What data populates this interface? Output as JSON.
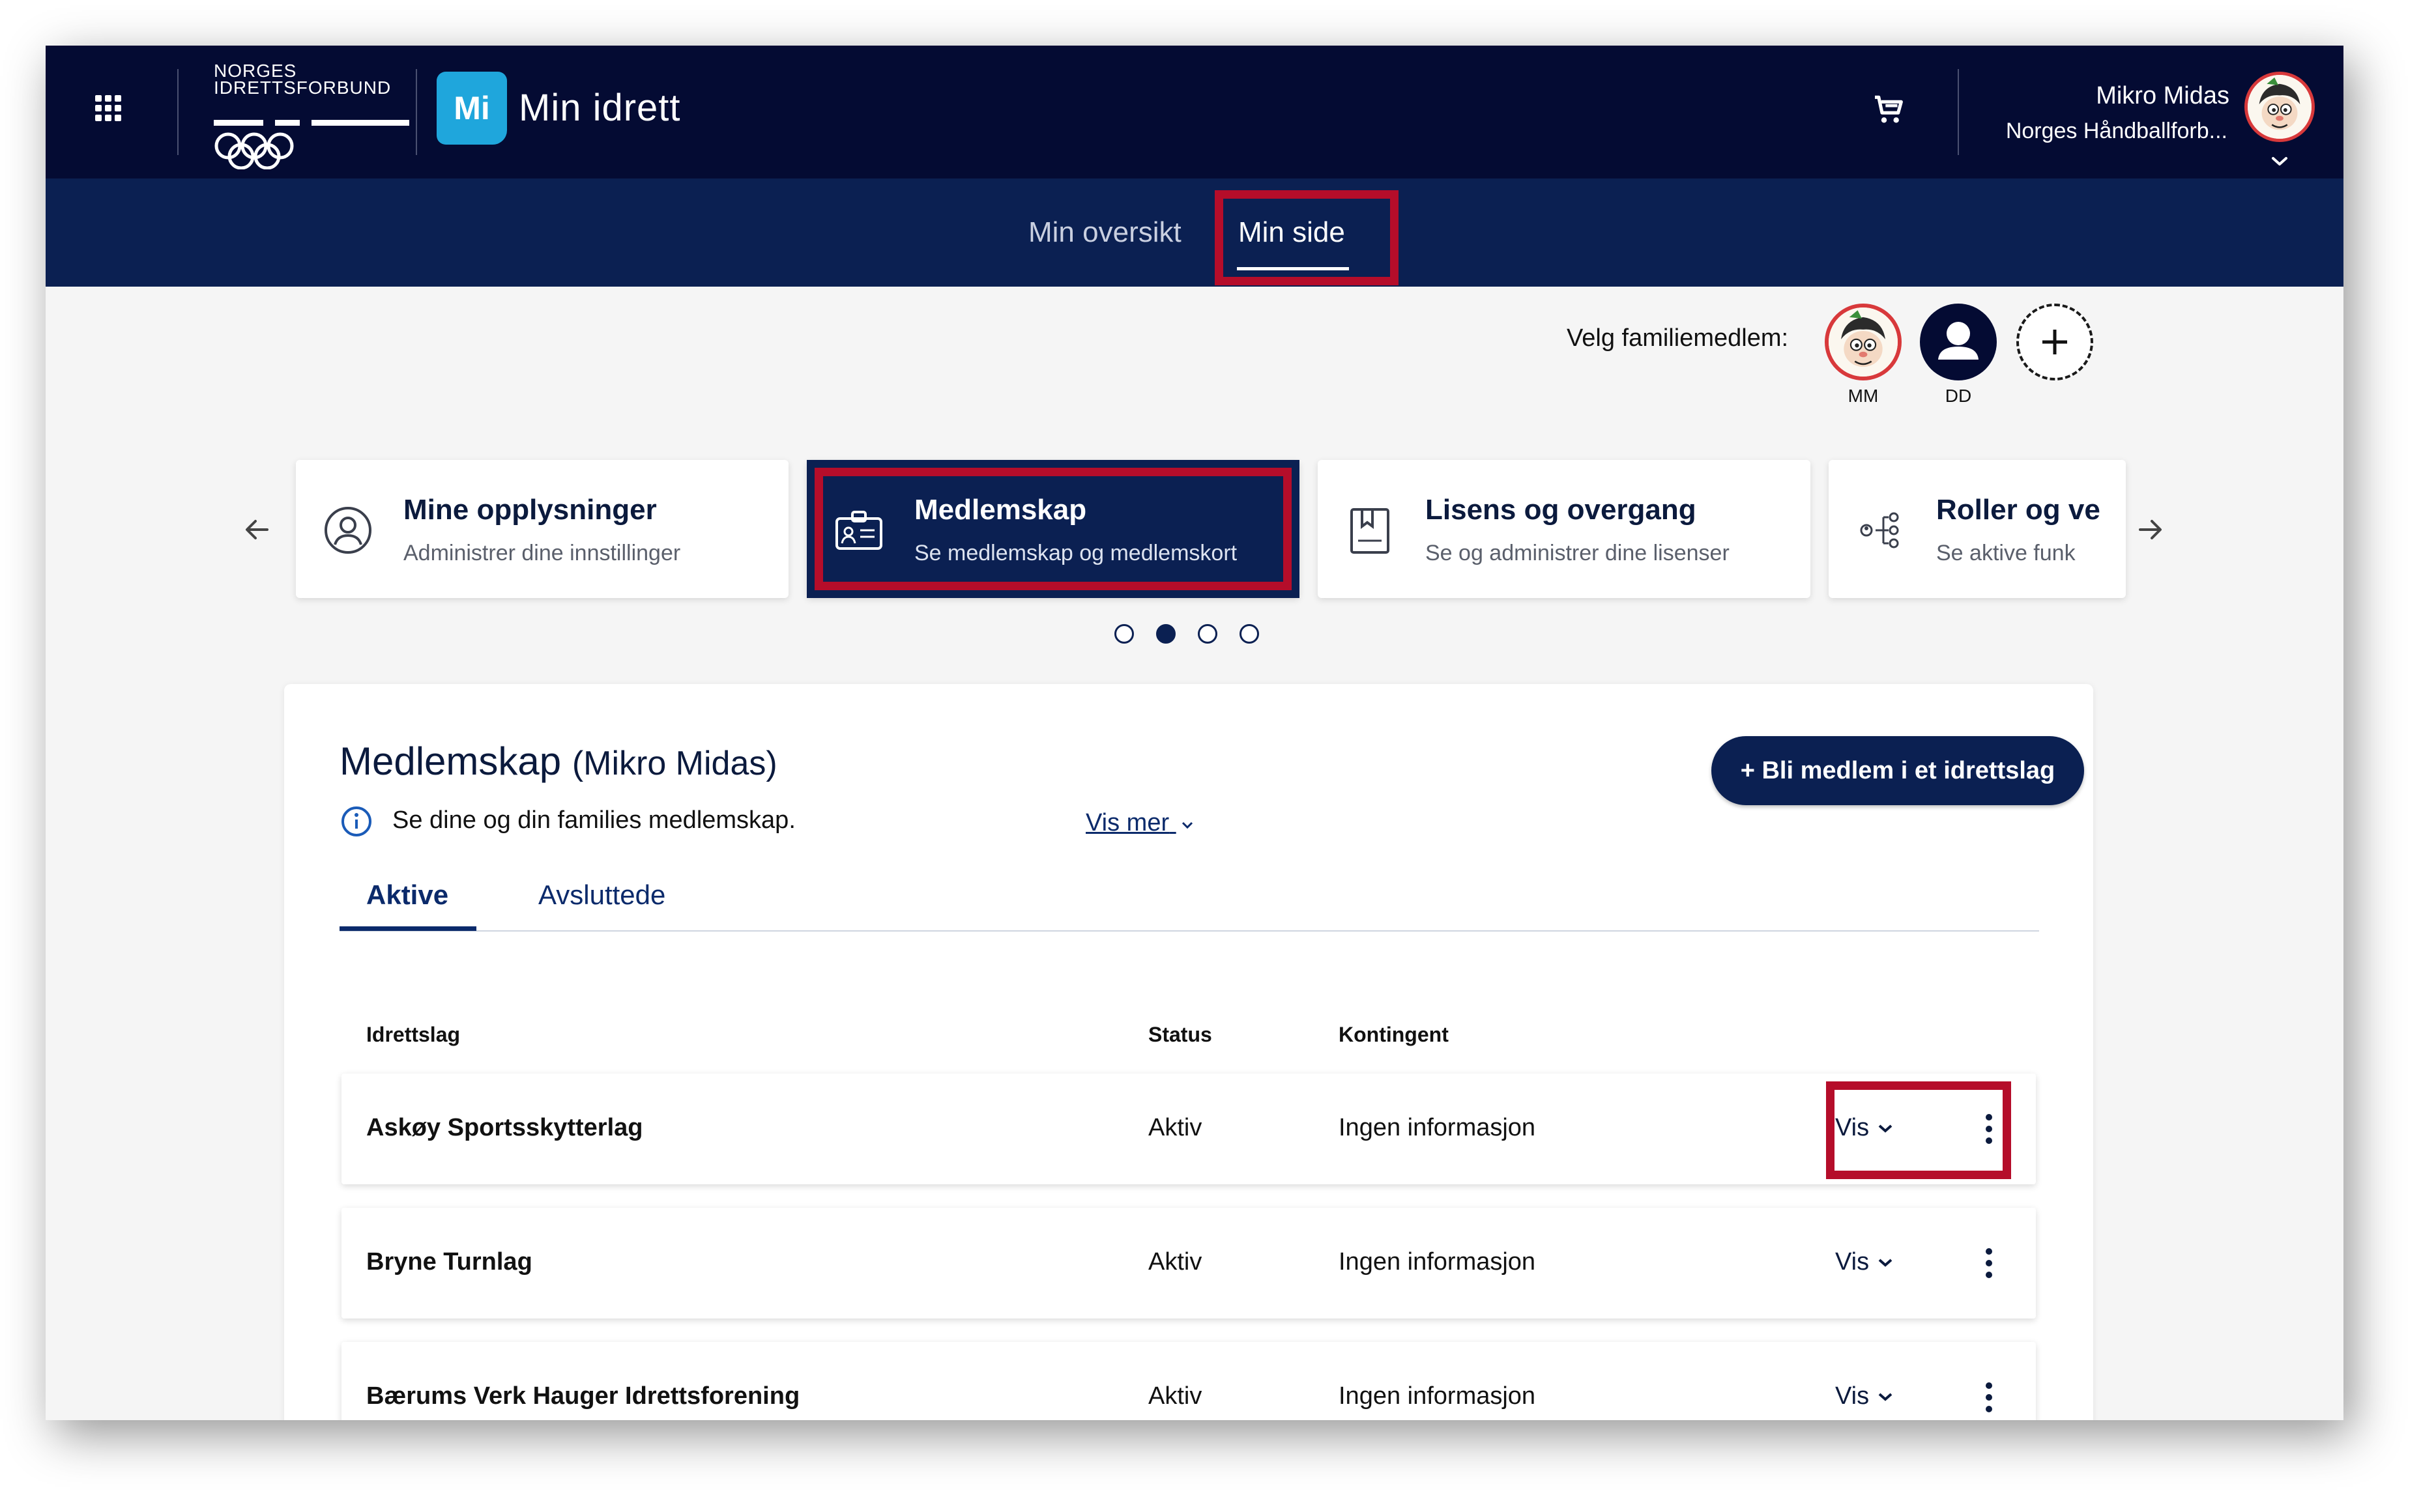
{
  "header": {
    "org_line1": "NORGES",
    "org_line2": "IDRETTSFORBUND",
    "app_badge": "Mi",
    "app_name": "Min idrett",
    "user_name": "Mikro Midas",
    "user_org": "Norges Håndballforb..."
  },
  "subnav": {
    "items": [
      {
        "label": "Min oversikt",
        "active": false
      },
      {
        "label": "Min side",
        "active": true
      }
    ]
  },
  "family": {
    "label": "Velg familiemedlem:",
    "members": [
      {
        "initials": "MM"
      },
      {
        "initials": "DD"
      }
    ]
  },
  "cards": [
    {
      "title": "Mine opplysninger",
      "subtitle": "Administrer dine innstillinger",
      "icon": "person-circle-icon"
    },
    {
      "title": "Medlemskap",
      "subtitle": "Se medlemskap og medlemskort",
      "icon": "id-card-icon"
    },
    {
      "title": "Lisens og overgang",
      "subtitle": "Se og administrer dine lisenser",
      "icon": "license-icon"
    },
    {
      "title": "Roller og ve",
      "subtitle": "Se aktive funk",
      "icon": "roles-icon"
    }
  ],
  "carousel": {
    "dots": 4,
    "active_index": 1
  },
  "panel": {
    "title": "Medlemskap",
    "title_sub": "(Mikro Midas)",
    "info_text": "Se dine og din families medlemskap.",
    "vis_mer": "Vis mer",
    "join_button": "+ Bli medlem i et idrettslag",
    "tabs": [
      {
        "label": "Aktive",
        "active": true
      },
      {
        "label": "Avsluttede",
        "active": false
      }
    ],
    "columns": [
      "Idrettslag",
      "Status",
      "Kontingent"
    ],
    "rows": [
      {
        "club": "Askøy Sportsskytterlag",
        "status": "Aktiv",
        "fee": "Ingen informasjon",
        "action": "Vis"
      },
      {
        "club": "Bryne Turnlag",
        "status": "Aktiv",
        "fee": "Ingen informasjon",
        "action": "Vis"
      },
      {
        "club": "Bærums Verk Hauger Idrettsforening",
        "status": "Aktiv",
        "fee": "Ingen informasjon",
        "action": "Vis"
      }
    ]
  },
  "colors": {
    "topbar": "#040b33",
    "subnav": "#0b2052",
    "highlight": "#b50d2a",
    "mi_badge": "#1fa6dc"
  }
}
